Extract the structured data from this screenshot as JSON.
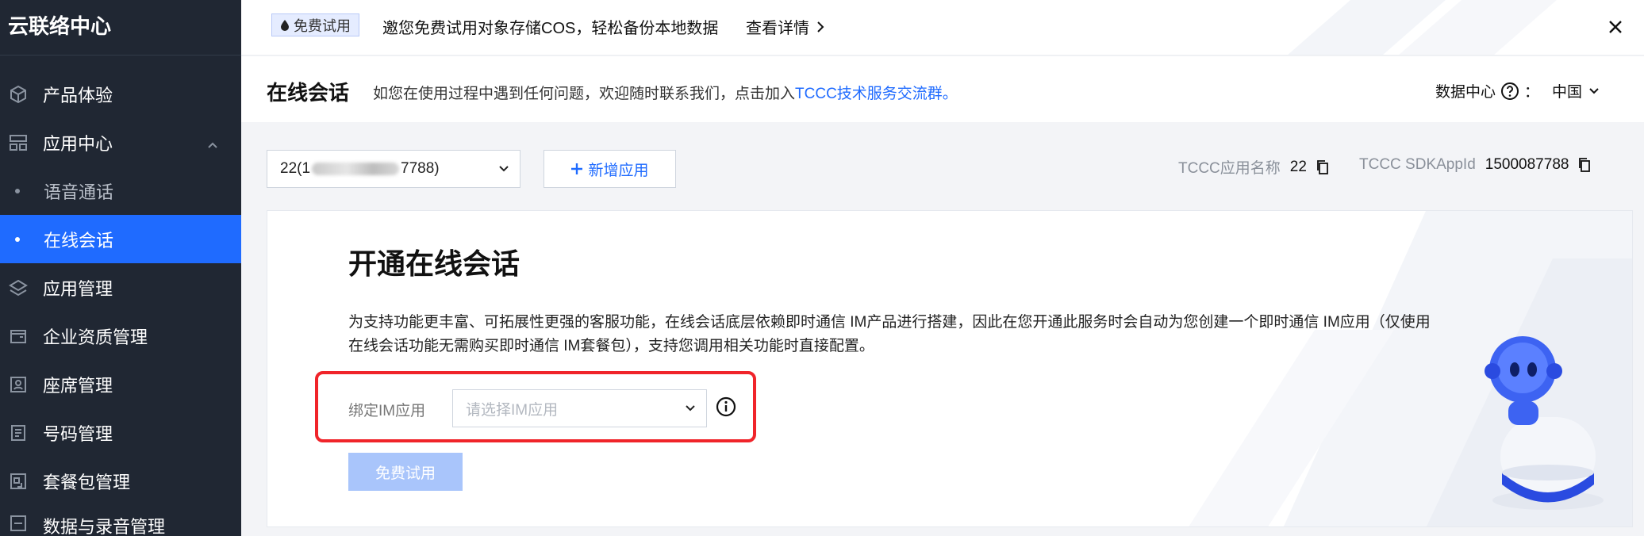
{
  "sidebar": {
    "brand": "云联络中心",
    "items": [
      {
        "label": "产品体验",
        "icon": "cube-icon"
      },
      {
        "label": "应用中心",
        "icon": "grid-icon"
      },
      {
        "label": "语音通话"
      },
      {
        "label": "在线会话"
      },
      {
        "label": "应用管理",
        "icon": "layers-icon"
      },
      {
        "label": "企业资质管理",
        "icon": "folder-icon"
      },
      {
        "label": "座席管理",
        "icon": "agent-icon"
      },
      {
        "label": "号码管理",
        "icon": "document-icon"
      },
      {
        "label": "套餐包管理",
        "icon": "package-icon"
      },
      {
        "label": "数据与录音管理",
        "icon": "data-icon"
      }
    ]
  },
  "banner": {
    "tag": "免费试用",
    "text": "邀您免费试用对象存储COS，轻松备份本地数据",
    "link": "查看详情"
  },
  "header": {
    "title": "在线会话",
    "desc": "如您在使用过程中遇到任何问题，欢迎随时联系我们，点击加入",
    "desc_link": "TCCC技术服务交流群。",
    "data_center_label": "数据中心",
    "data_center_colon": "：",
    "region": "中国"
  },
  "toolbar": {
    "app_select_prefix": "22(1",
    "app_select_suffix": "7788)",
    "add_app": "新增应用",
    "app_name_key": "TCCC应用名称",
    "app_name_value": "22",
    "sdkappid_key": "TCCC SDKAppId",
    "sdkappid_value": "1500087788"
  },
  "card": {
    "title": "开通在线会话",
    "paragraph": "为支持功能更丰富、可拓展性更强的客服功能，在线会话底层依赖即时通信 IM产品进行搭建，因此在您开通此服务时会自动为您创建一个即时通信 IM应用（仅使用在线会话功能无需购买即时通信 IM套餐包），支持您调用相关功能时直接配置。",
    "bind_label": "绑定IM应用",
    "bind_placeholder": "请选择IM应用",
    "trial_button": "免费试用"
  },
  "colors": {
    "sidebar_bg": "#202733",
    "accent": "#1f6bff",
    "highlight": "#f0242a",
    "disabled_button": "#a9c5fb"
  }
}
